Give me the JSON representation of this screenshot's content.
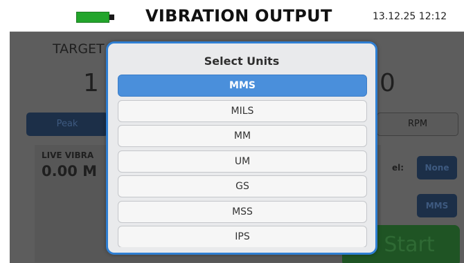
{
  "header": {
    "title": "VIBRATION OUTPUT",
    "datetime": "13.12.25 12:12",
    "battery_color": "#22a52b"
  },
  "background": {
    "target_label": "TARGET",
    "target_value": "1",
    "right_value": "0",
    "peak_label": "Peak",
    "rpm_label": "RPM",
    "live_label": "LIVE VIBRA",
    "live_value": "0.00 M",
    "level_label": "el:",
    "none_label": "None",
    "unit_label": "MMS",
    "start_label": "Start"
  },
  "modal": {
    "title": "Select Units",
    "selected": "MMS",
    "options": [
      "MMS",
      "MILS",
      "MM",
      "UM",
      "GS",
      "MSS",
      "IPS"
    ],
    "accent_color": "#4a8fdb"
  }
}
